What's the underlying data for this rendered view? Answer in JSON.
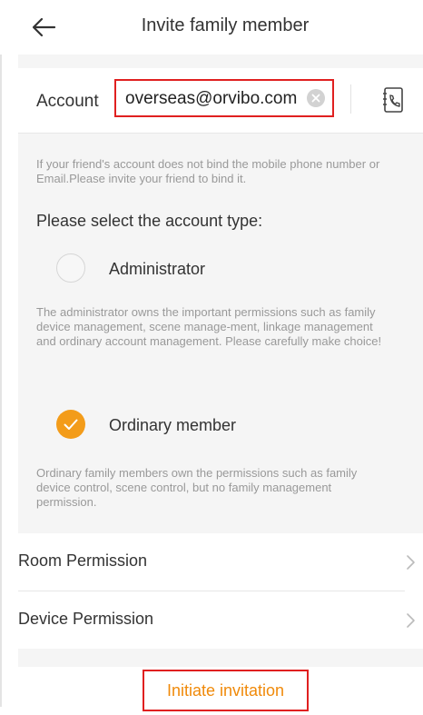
{
  "header": {
    "title": "Invite family member"
  },
  "account": {
    "label": "Account",
    "value": "overseas@orvibo.com"
  },
  "hint": "If your friend's account does not bind the mobile phone number or Email.Please invite your friend to bind it.",
  "account_type": {
    "title": "Please select the account type:",
    "options": [
      {
        "label": "Administrator",
        "selected": false,
        "description": "The administrator owns the important permissions such as family device management, scene manage-ment, linkage management and ordinary account management. Please carefully make choice!"
      },
      {
        "label": "Ordinary member",
        "selected": true,
        "description": "Ordinary family members own the permissions such as family device control, scene control, but no family management permission."
      }
    ]
  },
  "permissions": [
    {
      "label": "Room Permission"
    },
    {
      "label": "Device Permission"
    }
  ],
  "invite_button": {
    "label": "Initiate invitation"
  },
  "colors": {
    "accent": "#f39c1a",
    "button_text": "#f08a0a",
    "highlight_box": "#e02020",
    "background_gray": "#f5f5f5"
  }
}
